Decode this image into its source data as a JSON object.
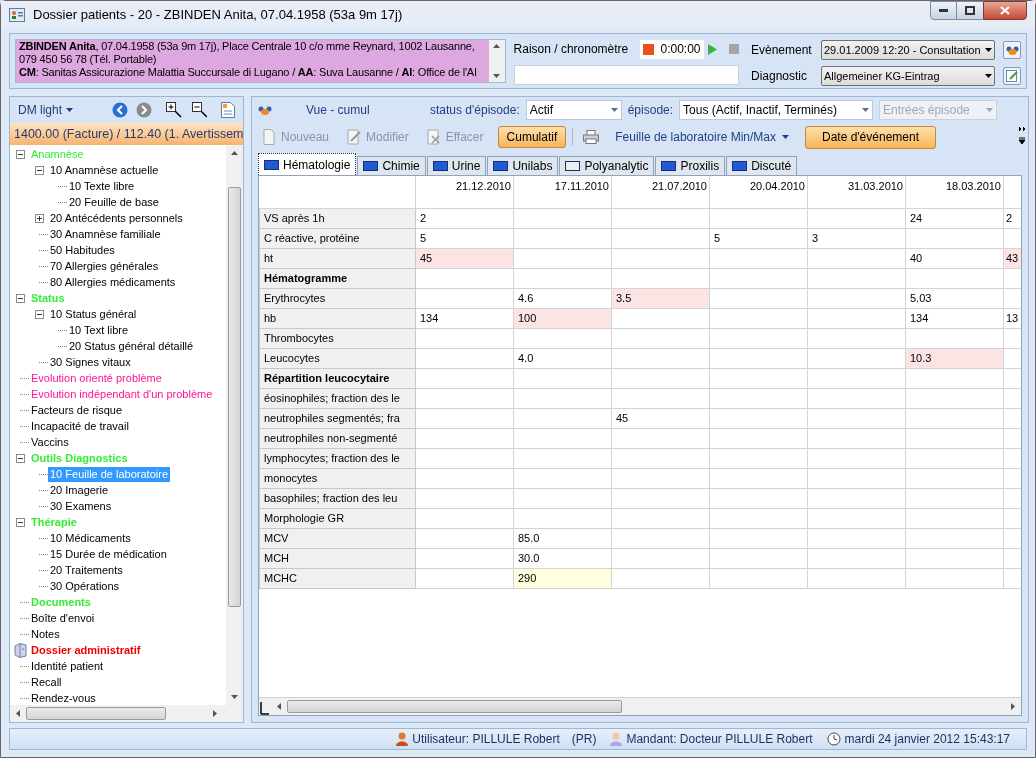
{
  "window": {
    "title": "Dossier patients - 20 - ZBINDEN Anita, 07.04.1958 (53a 9m 17j)"
  },
  "patient_banner": {
    "lines": [
      "**ZBINDEN Anita**, 07.04.1958 (53a 9m 17j), Place Centrale 10 c/o mme Reynard, 1002 Lausanne, 079 450 56 78 (Tél. Portable)",
      "**CM**: Sanitas Assicurazione Malattia Succursale di Lugano / **AA**: Suva Lausanne / **AI**: Office de l'AI"
    ]
  },
  "timer": {
    "label": "Raison / chronomètre",
    "time": "0:00:00"
  },
  "event": {
    "label": "Evènement",
    "value": "29.01.2009 12:20 - Consultation"
  },
  "diagnostic": {
    "label": "Diagnostic",
    "value": "Allgemeiner KG-Eintrag"
  },
  "sidebar": {
    "view_menu": "DM light",
    "balance": "1400.00 (Facture) / 112.40 (1. Avertissem",
    "tree": [
      {
        "label": "Anamnèse",
        "kind": "item",
        "color": "#33ee33",
        "selected": false,
        "expanded": true,
        "children": [
          {
            "label": "10 Anamnèse actuelle",
            "kind": "item",
            "selected": false,
            "expanded": true,
            "children": [
              {
                "label": "10 Texte libre",
                "kind": "item",
                "selected": false
              },
              {
                "label": "20 Feuille de base",
                "kind": "item",
                "selected": false
              }
            ]
          },
          {
            "label": "20 Antécédents personnels",
            "kind": "item",
            "selected": false,
            "expanded": false
          },
          {
            "label": "30 Anamnèse familiale",
            "kind": "item",
            "selected": false
          },
          {
            "label": "50 Habitudes",
            "kind": "item",
            "selected": false
          },
          {
            "label": "70 Allergies générales",
            "kind": "item",
            "selected": false
          },
          {
            "label": "80 Allergies médicaments",
            "kind": "item",
            "selected": false
          }
        ]
      },
      {
        "label": "Status",
        "kind": "heading",
        "color": "#33ee33",
        "selected": false,
        "expanded": true,
        "children": [
          {
            "label": "10 Status général",
            "kind": "item",
            "selected": false,
            "expanded": true,
            "children": [
              {
                "label": "10 Text libre",
                "kind": "item",
                "selected": false
              },
              {
                "label": "20 Status général détaillé",
                "kind": "item",
                "selected": false
              }
            ]
          },
          {
            "label": "30 Signes vitaux",
            "kind": "item",
            "selected": false
          }
        ]
      },
      {
        "label": "Evolution orienté problème",
        "kind": "item",
        "color": "#ff1493",
        "selected": false
      },
      {
        "label": "Evolution indépendant d'un problème",
        "kind": "item",
        "color": "#ff1493",
        "selected": false
      },
      {
        "label": "Facteurs de risque",
        "kind": "item",
        "selected": false
      },
      {
        "label": "Incapacité de travail",
        "kind": "item",
        "selected": false
      },
      {
        "label": "Vaccins",
        "kind": "item",
        "selected": false
      },
      {
        "label": "Outils Diagnostics",
        "kind": "heading",
        "color": "#33ee33",
        "selected": false,
        "expanded": true,
        "children": [
          {
            "label": "10 Feuille de laboratoire",
            "kind": "item",
            "selected": true
          },
          {
            "label": "20 Imagerie",
            "kind": "item",
            "selected": false
          },
          {
            "label": "30 Examens",
            "kind": "item",
            "selected": false
          }
        ]
      },
      {
        "label": "Thérapie",
        "kind": "heading",
        "color": "#33ee33",
        "selected": false,
        "expanded": true,
        "children": [
          {
            "label": "10 Médicaments",
            "kind": "item",
            "selected": false
          },
          {
            "label": "15 Durée de médication",
            "kind": "item",
            "selected": false
          },
          {
            "label": "20 Traitements",
            "kind": "item",
            "selected": false
          },
          {
            "label": "30 Opérations",
            "kind": "item",
            "selected": false
          }
        ]
      },
      {
        "label": "Documents",
        "kind": "heading",
        "color": "#33ee33",
        "selected": false
      },
      {
        "label": "Boîte d'envoi",
        "kind": "item",
        "selected": false
      },
      {
        "label": "Notes",
        "kind": "item",
        "selected": false
      },
      {
        "label": "Dossier administratif",
        "kind": "folder",
        "color": "#ee0000",
        "selected": false
      },
      {
        "label": "Identité patient",
        "kind": "item",
        "selected": false
      },
      {
        "label": "Recall",
        "kind": "item",
        "selected": false
      },
      {
        "label": "Rendez-vous",
        "kind": "item",
        "selected": false
      }
    ]
  },
  "toolbar": {
    "view_label": "Vue - cumul",
    "episode_status": {
      "label": "status d'épisode:",
      "value": "Actif"
    },
    "episode": {
      "label": "épisode:",
      "value": "Tous (Actif, Inactif, Terminés)"
    },
    "episode_entries": {
      "value": "Entrées épisode",
      "disabled": true
    }
  },
  "actions": [
    {
      "label": "Nouveau",
      "kind": "button",
      "disabled": true
    },
    {
      "label": "Modifier",
      "kind": "button",
      "disabled": true
    },
    {
      "label": "Effacer",
      "kind": "button",
      "disabled": true
    },
    {
      "label": "Cumulatif",
      "kind": "toggle",
      "selected": true
    },
    {
      "label": "Feuille de laboratoire Min/Max",
      "kind": "dropdown"
    },
    {
      "label": "Date d'événement",
      "kind": "highlight"
    }
  ],
  "tabs": [
    {
      "label": "Hématologie",
      "selected": true,
      "color": "#1e5bd6"
    },
    {
      "label": "Chimie",
      "selected": false,
      "color": "#1e5bd6"
    },
    {
      "label": "Urine",
      "selected": false,
      "color": "#1e5bd6"
    },
    {
      "label": "Unilabs",
      "selected": false,
      "color": "#1e5bd6"
    },
    {
      "label": "Polyanalytic",
      "selected": false,
      "color": "#eeeeee"
    },
    {
      "label": "Proxilis",
      "selected": false,
      "color": "#1e5bd6"
    },
    {
      "label": "Discuté",
      "selected": false,
      "color": "#1e5bd6"
    }
  ],
  "table": {
    "columns": [
      "21.12.2010",
      "17.11.2010",
      "21.07.2010",
      "20.04.2010",
      "31.03.2010",
      "18.03.2010"
    ],
    "rows": [
      {
        "label": "VS après 1h",
        "kind": "value",
        "cells": [
          {
            "text": "2"
          },
          null,
          null,
          null,
          null,
          {
            "text": "24"
          },
          {
            "text": "2"
          }
        ]
      },
      {
        "label": "C réactive, protéine",
        "kind": "value",
        "cells": [
          {
            "text": "5"
          },
          null,
          null,
          {
            "text": "5"
          },
          {
            "text": "3"
          },
          null,
          null
        ]
      },
      {
        "label": "ht",
        "kind": "value",
        "cells": [
          {
            "text": "45",
            "color": "#fde4e4"
          },
          null,
          null,
          null,
          null,
          {
            "text": "40"
          },
          {
            "text": "43",
            "color": "#fde4e4"
          }
        ]
      },
      {
        "label": "Hématogramme",
        "kind": "heading",
        "cells": [
          null,
          null,
          null,
          null,
          null,
          null,
          null
        ]
      },
      {
        "label": "Erythrocytes",
        "kind": "value",
        "cells": [
          null,
          {
            "text": "4.6"
          },
          {
            "text": "3.5",
            "color": "#fde4e4"
          },
          null,
          null,
          {
            "text": "5.03"
          },
          null
        ]
      },
      {
        "label": "hb",
        "kind": "value",
        "cells": [
          {
            "text": "134"
          },
          {
            "text": "100",
            "color": "#fde4e4"
          },
          null,
          null,
          null,
          {
            "text": "134"
          },
          {
            "text": "13"
          }
        ]
      },
      {
        "label": "Thrombocytes",
        "kind": "value",
        "cells": [
          null,
          null,
          null,
          null,
          null,
          null,
          null
        ]
      },
      {
        "label": "Leucocytes",
        "kind": "value",
        "cells": [
          null,
          {
            "text": "4.0"
          },
          null,
          null,
          null,
          {
            "text": "10.3",
            "color": "#fde4e4"
          },
          null
        ]
      },
      {
        "label": "Répartition leucocytaire",
        "kind": "heading",
        "cells": [
          null,
          null,
          null,
          null,
          null,
          null,
          null
        ]
      },
      {
        "label": "éosinophiles; fraction des le",
        "kind": "value",
        "cells": [
          null,
          null,
          null,
          null,
          null,
          null,
          null
        ]
      },
      {
        "label": "neutrophiles segmentés; fra",
        "kind": "value",
        "cells": [
          null,
          null,
          {
            "text": "45"
          },
          null,
          null,
          null,
          null
        ]
      },
      {
        "label": "neutrophiles non-segmenté",
        "kind": "value",
        "cells": [
          null,
          null,
          null,
          null,
          null,
          null,
          null
        ]
      },
      {
        "label": "lymphocytes; fraction des le",
        "kind": "value",
        "cells": [
          null,
          null,
          null,
          null,
          null,
          null,
          null
        ]
      },
      {
        "label": "monocytes",
        "kind": "value",
        "cells": [
          null,
          null,
          null,
          null,
          null,
          null,
          null
        ]
      },
      {
        "label": "basophiles; fraction des leu",
        "kind": "value",
        "cells": [
          null,
          null,
          null,
          null,
          null,
          null,
          null
        ]
      },
      {
        "label": "Morphologie GR",
        "kind": "value",
        "cells": [
          null,
          null,
          null,
          null,
          null,
          null,
          null
        ]
      },
      {
        "label": "MCV",
        "kind": "value",
        "cells": [
          null,
          {
            "text": "85.0"
          },
          null,
          null,
          null,
          null,
          null
        ]
      },
      {
        "label": "MCH",
        "kind": "value",
        "cells": [
          null,
          {
            "text": "30.0"
          },
          null,
          null,
          null,
          null,
          null
        ]
      },
      {
        "label": "MCHC",
        "kind": "value",
        "cells": [
          null,
          {
            "text": "290",
            "color": "#ffffe0"
          },
          null,
          null,
          null,
          null,
          null
        ]
      }
    ]
  },
  "status_bar": {
    "user": "Utilisateur: PILLULE Robert",
    "user_code": "(PR)",
    "mandant": "Mandant: Docteur PILLULE Robert",
    "datetime": "mardi 24 janvier 2012 15:43:17"
  }
}
